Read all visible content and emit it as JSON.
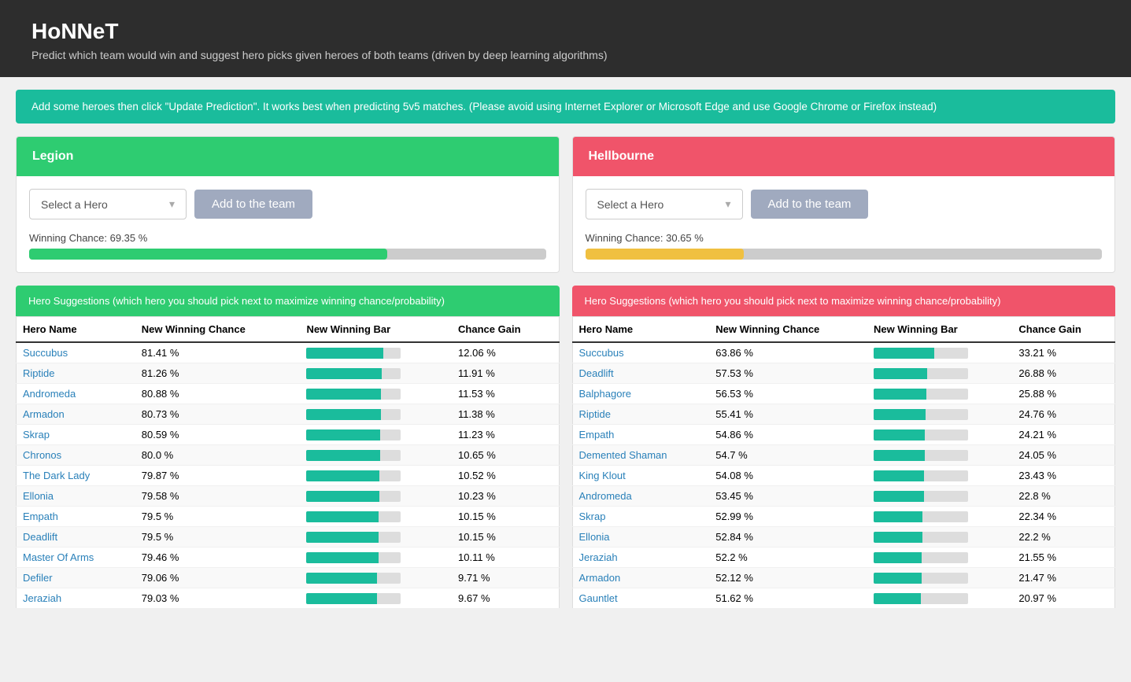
{
  "header": {
    "title": "HoNNeT",
    "subtitle": "Predict which team would win and suggest hero picks given heroes of both teams (driven by deep learning algorithms)"
  },
  "info_banner": "Add some heroes then click \"Update Prediction\". It works best when predicting 5v5 matches. (Please avoid using Internet Explorer or Microsoft Edge and use Google Chrome or Firefox instead)",
  "teams": {
    "legion": {
      "name": "Legion",
      "header_class": "legion",
      "select_placeholder": "Select a Hero",
      "add_label": "Add to the team",
      "winning_label": "Winning Chance: 69.35 %",
      "winning_pct": 69.35,
      "bar_class": "green",
      "suggestions_header": "Hero Suggestions (which hero you should pick next to maximize winning chance/probability)",
      "suggestions_class": "legion-sug",
      "table": {
        "cols": [
          "Hero Name",
          "New Winning Chance",
          "New Winning Bar",
          "Chance Gain"
        ],
        "rows": [
          {
            "hero": "Succubus",
            "chance": "81.41 %",
            "bar": 81,
            "gain": "12.06 %"
          },
          {
            "hero": "Riptide",
            "chance": "81.26 %",
            "bar": 80,
            "gain": "11.91 %"
          },
          {
            "hero": "Andromeda",
            "chance": "80.88 %",
            "bar": 79,
            "gain": "11.53 %"
          },
          {
            "hero": "Armadon",
            "chance": "80.73 %",
            "bar": 79,
            "gain": "11.38 %"
          },
          {
            "hero": "Skrap",
            "chance": "80.59 %",
            "bar": 78,
            "gain": "11.23 %"
          },
          {
            "hero": "Chronos",
            "chance": "80.0 %",
            "bar": 78,
            "gain": "10.65 %"
          },
          {
            "hero": "The Dark Lady",
            "chance": "79.87 %",
            "bar": 77,
            "gain": "10.52 %"
          },
          {
            "hero": "Ellonia",
            "chance": "79.58 %",
            "bar": 77,
            "gain": "10.23 %"
          },
          {
            "hero": "Empath",
            "chance": "79.5 %",
            "bar": 76,
            "gain": "10.15 %"
          },
          {
            "hero": "Deadlift",
            "chance": "79.5 %",
            "bar": 76,
            "gain": "10.15 %"
          },
          {
            "hero": "Master Of Arms",
            "chance": "79.46 %",
            "bar": 76,
            "gain": "10.11 %"
          },
          {
            "hero": "Defiler",
            "chance": "79.06 %",
            "bar": 75,
            "gain": "9.71 %"
          },
          {
            "hero": "Jeraziah",
            "chance": "79.03 %",
            "bar": 75,
            "gain": "9.67 %"
          }
        ]
      }
    },
    "hellbourne": {
      "name": "Hellbourne",
      "header_class": "hellbourne",
      "select_placeholder": "Select a Hero",
      "add_label": "Add to the team",
      "winning_label": "Winning Chance: 30.65 %",
      "winning_pct": 30.65,
      "bar_class": "yellow",
      "suggestions_header": "Hero Suggestions (which hero you should pick next to maximize winning chance/probability)",
      "suggestions_class": "hellbourne-sug",
      "table": {
        "cols": [
          "Hero Name",
          "New Winning Chance",
          "New Winning Bar",
          "Chance Gain"
        ],
        "rows": [
          {
            "hero": "Succubus",
            "chance": "63.86 %",
            "bar": 64,
            "gain": "33.21 %"
          },
          {
            "hero": "Deadlift",
            "chance": "57.53 %",
            "bar": 57,
            "gain": "26.88 %"
          },
          {
            "hero": "Balphagore",
            "chance": "56.53 %",
            "bar": 56,
            "gain": "25.88 %"
          },
          {
            "hero": "Riptide",
            "chance": "55.41 %",
            "bar": 55,
            "gain": "24.76 %"
          },
          {
            "hero": "Empath",
            "chance": "54.86 %",
            "bar": 54,
            "gain": "24.21 %"
          },
          {
            "hero": "Demented Shaman",
            "chance": "54.7 %",
            "bar": 54,
            "gain": "24.05 %"
          },
          {
            "hero": "King Klout",
            "chance": "54.08 %",
            "bar": 53,
            "gain": "23.43 %"
          },
          {
            "hero": "Andromeda",
            "chance": "53.45 %",
            "bar": 53,
            "gain": "22.8 %"
          },
          {
            "hero": "Skrap",
            "chance": "52.99 %",
            "bar": 52,
            "gain": "22.34 %"
          },
          {
            "hero": "Ellonia",
            "chance": "52.84 %",
            "bar": 52,
            "gain": "22.2 %"
          },
          {
            "hero": "Jeraziah",
            "chance": "52.2 %",
            "bar": 51,
            "gain": "21.55 %"
          },
          {
            "hero": "Armadon",
            "chance": "52.12 %",
            "bar": 51,
            "gain": "21.47 %"
          },
          {
            "hero": "Gauntlet",
            "chance": "51.62 %",
            "bar": 50,
            "gain": "20.97 %"
          }
        ]
      }
    }
  }
}
